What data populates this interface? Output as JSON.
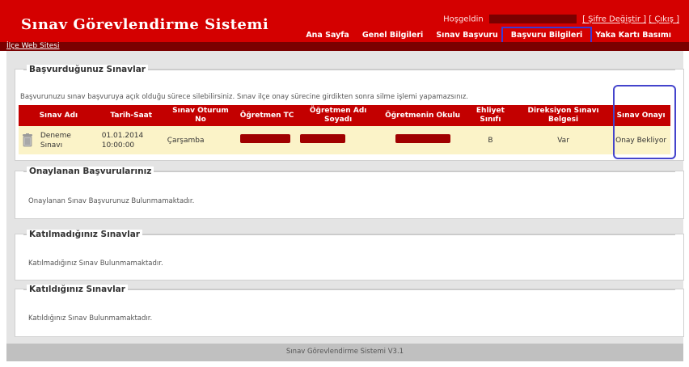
{
  "header": {
    "title": "Sınav Görevlendirme Sistemi",
    "welcome": "Hoşgeldin",
    "change_password": "[ Şifre Değiştir ]",
    "logout": "[ Çıkış ]"
  },
  "nav": {
    "items": [
      "Ana Sayfa",
      "Genel Bilgileri",
      "Sınav Başvuru",
      "Başvuru Bilgileri",
      "Yaka Kartı Basımı"
    ],
    "active_index": 3
  },
  "subbar": {
    "link": "İlçe Web Sitesi"
  },
  "applied": {
    "legend": "Başvurduğunuz Sınavlar",
    "note": "Başvurunuzu sınav başvuruya açık olduğu sürece silebilirsiniz. Sınav ilçe onay sürecine girdikten sonra silme işlemi yapamazsınız.",
    "columns": [
      "Sınav Adı",
      "Tarih-Saat",
      "Sınav Oturum No",
      "Öğretmen TC",
      "Öğretmen Adı Soyadı",
      "Öğretmenin Okulu",
      "Ehliyet Sınıfı",
      "Direksiyon Sınavı Belgesi",
      "Sınav Onayı"
    ],
    "row": {
      "exam_name": "Deneme Sınavı",
      "datetime": "01.01.2014 10:00:00",
      "session": "Çarşamba",
      "license_class": "B",
      "driving_cert": "Var",
      "approval": "Onay Bekliyor"
    }
  },
  "approved": {
    "legend": "Onaylanan Başvurularınız",
    "message": "Onaylanan Sınav Başvurunuz Bulunmamaktadır."
  },
  "not_attended": {
    "legend": "Katılmadığınız Sınavlar",
    "message": "Katılmadığınız Sınav Bulunmamaktadır."
  },
  "attended": {
    "legend": "Katıldığınız Sınavlar",
    "message": "Katıldığınız Sınav Bulunmamaktadır."
  },
  "footer": {
    "text": "Sınav Görevlendirme Sistemi V3.1"
  },
  "colors": {
    "header_red": "#d40000",
    "dark_red": "#7a0000",
    "table_header": "#c30000",
    "row_bg": "#fbf3c8",
    "annotation": "#4444cc"
  }
}
